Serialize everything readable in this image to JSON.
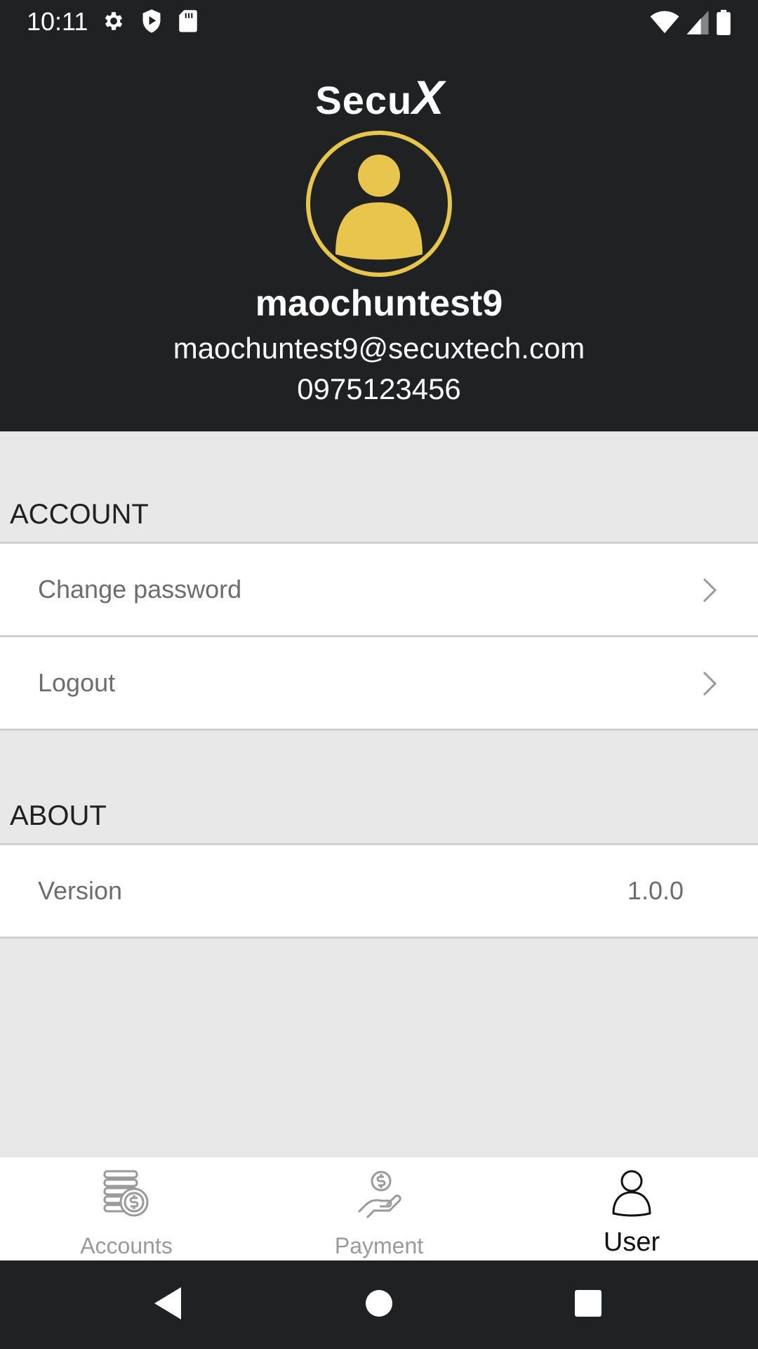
{
  "status_bar": {
    "time": "10:11",
    "left_icons": [
      "gear-icon",
      "shield-play-icon",
      "sd-card-icon"
    ],
    "right_icons": [
      "wifi-icon",
      "signal-icon",
      "battery-icon"
    ]
  },
  "header": {
    "logo": "Secu",
    "logo_x": "X",
    "avatar_icon": "user-avatar-icon",
    "username": "maochuntest9",
    "email": "maochuntest9@secuxtech.com",
    "phone": "0975123456"
  },
  "sections": {
    "account": {
      "title": "ACCOUNT",
      "items": [
        {
          "label": "Change password",
          "icon": "chevron-right-icon"
        },
        {
          "label": "Logout",
          "icon": "chevron-right-icon"
        }
      ]
    },
    "about": {
      "title": "ABOUT",
      "items": [
        {
          "label": "Version",
          "value": "1.0.0"
        }
      ]
    }
  },
  "bottom_nav": {
    "items": [
      {
        "label": "Accounts",
        "icon": "coins-icon",
        "active": false
      },
      {
        "label": "Payment",
        "icon": "hand-coin-icon",
        "active": false
      },
      {
        "label": "User",
        "icon": "user-icon",
        "active": true
      }
    ]
  },
  "system_nav": [
    "back-icon",
    "home-icon",
    "recents-icon"
  ],
  "colors": {
    "dark": "#202122",
    "accent": "#e8c54d",
    "background": "#e8e8e8",
    "muted_text": "#6d6d6d"
  }
}
